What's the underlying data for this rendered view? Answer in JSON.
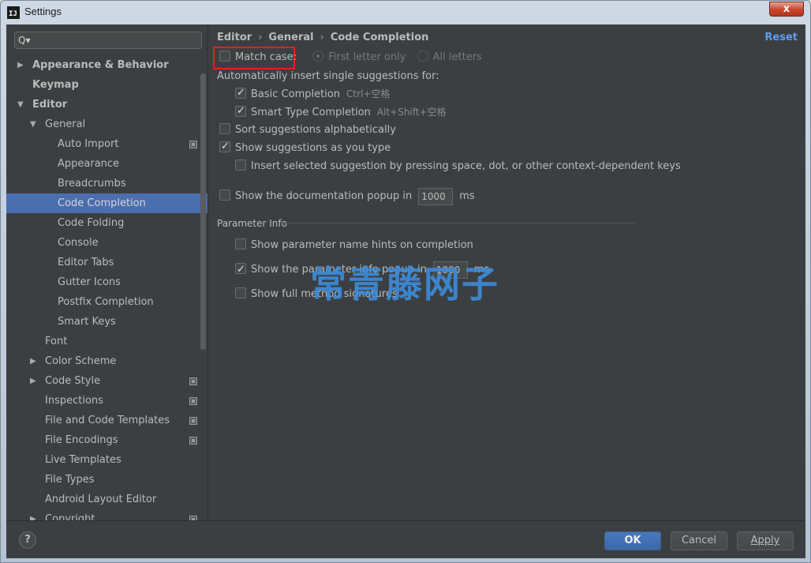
{
  "window": {
    "title": "Settings",
    "close_label": "x",
    "app_icon_label": "IJ"
  },
  "search": {
    "placeholder": "",
    "icon_label": "Q▾"
  },
  "sidebar": {
    "items": [
      {
        "label": "Appearance & Behavior",
        "level": 0,
        "bold": true,
        "arrow": "▶",
        "icon": false,
        "selected": false
      },
      {
        "label": "Keymap",
        "level": 0,
        "bold": true,
        "arrow": "",
        "icon": false,
        "selected": false
      },
      {
        "label": "Editor",
        "level": 0,
        "bold": true,
        "arrow": "▼",
        "icon": false,
        "selected": false
      },
      {
        "label": "General",
        "level": 1,
        "bold": false,
        "arrow": "▼",
        "icon": false,
        "selected": false
      },
      {
        "label": "Auto Import",
        "level": 2,
        "bold": false,
        "arrow": "",
        "icon": true,
        "selected": false
      },
      {
        "label": "Appearance",
        "level": 2,
        "bold": false,
        "arrow": "",
        "icon": false,
        "selected": false
      },
      {
        "label": "Breadcrumbs",
        "level": 2,
        "bold": false,
        "arrow": "",
        "icon": false,
        "selected": false
      },
      {
        "label": "Code Completion",
        "level": 2,
        "bold": false,
        "arrow": "",
        "icon": false,
        "selected": true
      },
      {
        "label": "Code Folding",
        "level": 2,
        "bold": false,
        "arrow": "",
        "icon": false,
        "selected": false
      },
      {
        "label": "Console",
        "level": 2,
        "bold": false,
        "arrow": "",
        "icon": false,
        "selected": false
      },
      {
        "label": "Editor Tabs",
        "level": 2,
        "bold": false,
        "arrow": "",
        "icon": false,
        "selected": false
      },
      {
        "label": "Gutter Icons",
        "level": 2,
        "bold": false,
        "arrow": "",
        "icon": false,
        "selected": false
      },
      {
        "label": "Postfix Completion",
        "level": 2,
        "bold": false,
        "arrow": "",
        "icon": false,
        "selected": false
      },
      {
        "label": "Smart Keys",
        "level": 2,
        "bold": false,
        "arrow": "",
        "icon": false,
        "selected": false
      },
      {
        "label": "Font",
        "level": 1,
        "bold": false,
        "arrow": "",
        "icon": false,
        "selected": false
      },
      {
        "label": "Color Scheme",
        "level": 1,
        "bold": false,
        "arrow": "▶",
        "icon": false,
        "selected": false
      },
      {
        "label": "Code Style",
        "level": 1,
        "bold": false,
        "arrow": "▶",
        "icon": true,
        "selected": false
      },
      {
        "label": "Inspections",
        "level": 1,
        "bold": false,
        "arrow": "",
        "icon": true,
        "selected": false
      },
      {
        "label": "File and Code Templates",
        "level": 1,
        "bold": false,
        "arrow": "",
        "icon": true,
        "selected": false
      },
      {
        "label": "File Encodings",
        "level": 1,
        "bold": false,
        "arrow": "",
        "icon": true,
        "selected": false
      },
      {
        "label": "Live Templates",
        "level": 1,
        "bold": false,
        "arrow": "",
        "icon": false,
        "selected": false
      },
      {
        "label": "File Types",
        "level": 1,
        "bold": false,
        "arrow": "",
        "icon": false,
        "selected": false
      },
      {
        "label": "Android Layout Editor",
        "level": 1,
        "bold": false,
        "arrow": "",
        "icon": false,
        "selected": false
      },
      {
        "label": "Copyright",
        "level": 1,
        "bold": false,
        "arrow": "▶",
        "icon": true,
        "selected": false
      }
    ]
  },
  "main": {
    "breadcrumb": [
      "Editor",
      "General",
      "Code Completion"
    ],
    "breadcrumb_sep": "›",
    "reset_label": "Reset",
    "match_case": {
      "label": "Match case:",
      "checked": false
    },
    "radio_first_letter": "First letter only",
    "radio_all_letters": "All letters",
    "auto_insert_label": "Automatically insert single suggestions for:",
    "basic_completion": {
      "label": "Basic Completion",
      "shortcut": "Ctrl+空格",
      "checked": true
    },
    "smart_type": {
      "label": "Smart Type Completion",
      "shortcut": "Alt+Shift+空格",
      "checked": true
    },
    "sort_alpha": {
      "label": "Sort suggestions alphabetically",
      "checked": false
    },
    "show_as_type": {
      "label": "Show suggestions as you type",
      "checked": true
    },
    "insert_selected": {
      "label": "Insert selected suggestion by pressing space, dot, or other context-dependent keys",
      "checked": false
    },
    "doc_popup": {
      "label": "Show the documentation popup in",
      "value": "1000",
      "unit": "ms",
      "checked": false
    },
    "param_section_title": "Parameter Info",
    "param_name_hints": {
      "label": "Show parameter name hints on completion",
      "checked": false
    },
    "param_info_popup": {
      "label": "Show the parameter info popup in",
      "value": "1000",
      "unit": "ms",
      "checked": true
    },
    "full_signatures": {
      "label": "Show full method signatures",
      "checked": false
    },
    "watermark": "常青藤网子"
  },
  "footer": {
    "help_label": "?",
    "ok_label": "OK",
    "cancel_label": "Cancel",
    "apply_label": "Apply"
  }
}
